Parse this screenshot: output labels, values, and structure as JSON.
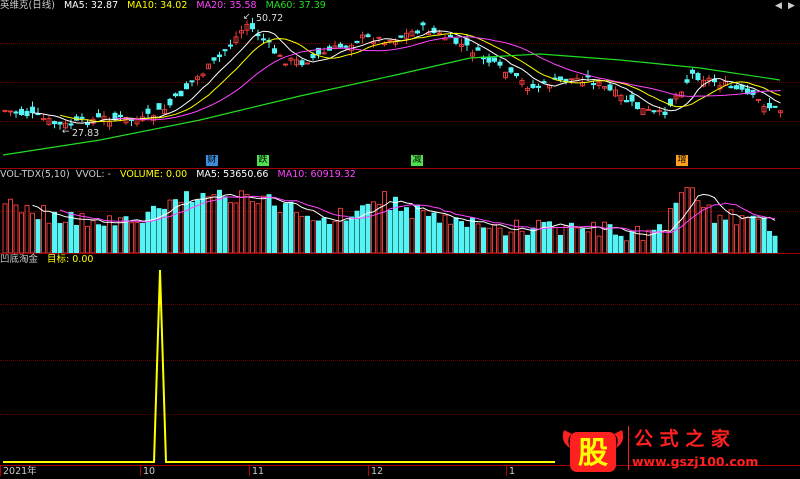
{
  "price_panel": {
    "title": "英维克(日线)",
    "ma": [
      {
        "label": "MA5: 32.87",
        "color": "#ffffff"
      },
      {
        "label": "MA10: 34.02",
        "color": "#ffff00"
      },
      {
        "label": "MA20: 35.58",
        "color": "#ff44ff"
      },
      {
        "label": "MA60: 37.39",
        "color": "#22dd22"
      }
    ],
    "high_label": "50.72",
    "low_label": "27.83",
    "markers": [
      {
        "text": "财",
        "color": "#3a8dd8"
      },
      {
        "text": "跌",
        "color": "#50e050"
      },
      {
        "text": "减",
        "color": "#50e050"
      },
      {
        "text": "增",
        "color": "#ffa020"
      }
    ]
  },
  "volume_panel": {
    "title": "VOL-TDX(5,10)",
    "vvol": "VVOL: -",
    "volume": "VOLUME: 0.00",
    "ma5": "MA5: 53650.66",
    "ma10": "MA10: 60919.32",
    "colors": {
      "up": "#e03a3a",
      "down": "#55f5f5",
      "ma5": "#ffffff",
      "ma10": "#ff44ff"
    }
  },
  "indicator_panel": {
    "title": "凹底淘金",
    "target": "目标: 0.00",
    "line_color": "#ffff00"
  },
  "time_axis": {
    "labels": [
      "2021年",
      "10",
      "11",
      "12",
      "1"
    ]
  },
  "controls": {
    "left_arrow": "◀",
    "right_arrow": "▶"
  },
  "watermark": {
    "logo_char": "股",
    "brand": "公 式 之 家",
    "url": "www.gszj100.com"
  },
  "colors": {
    "background": "#000000",
    "grid": "#7a0000",
    "separator": "#a00000",
    "up": "#e03a3a",
    "down": "#55f5f5"
  }
}
